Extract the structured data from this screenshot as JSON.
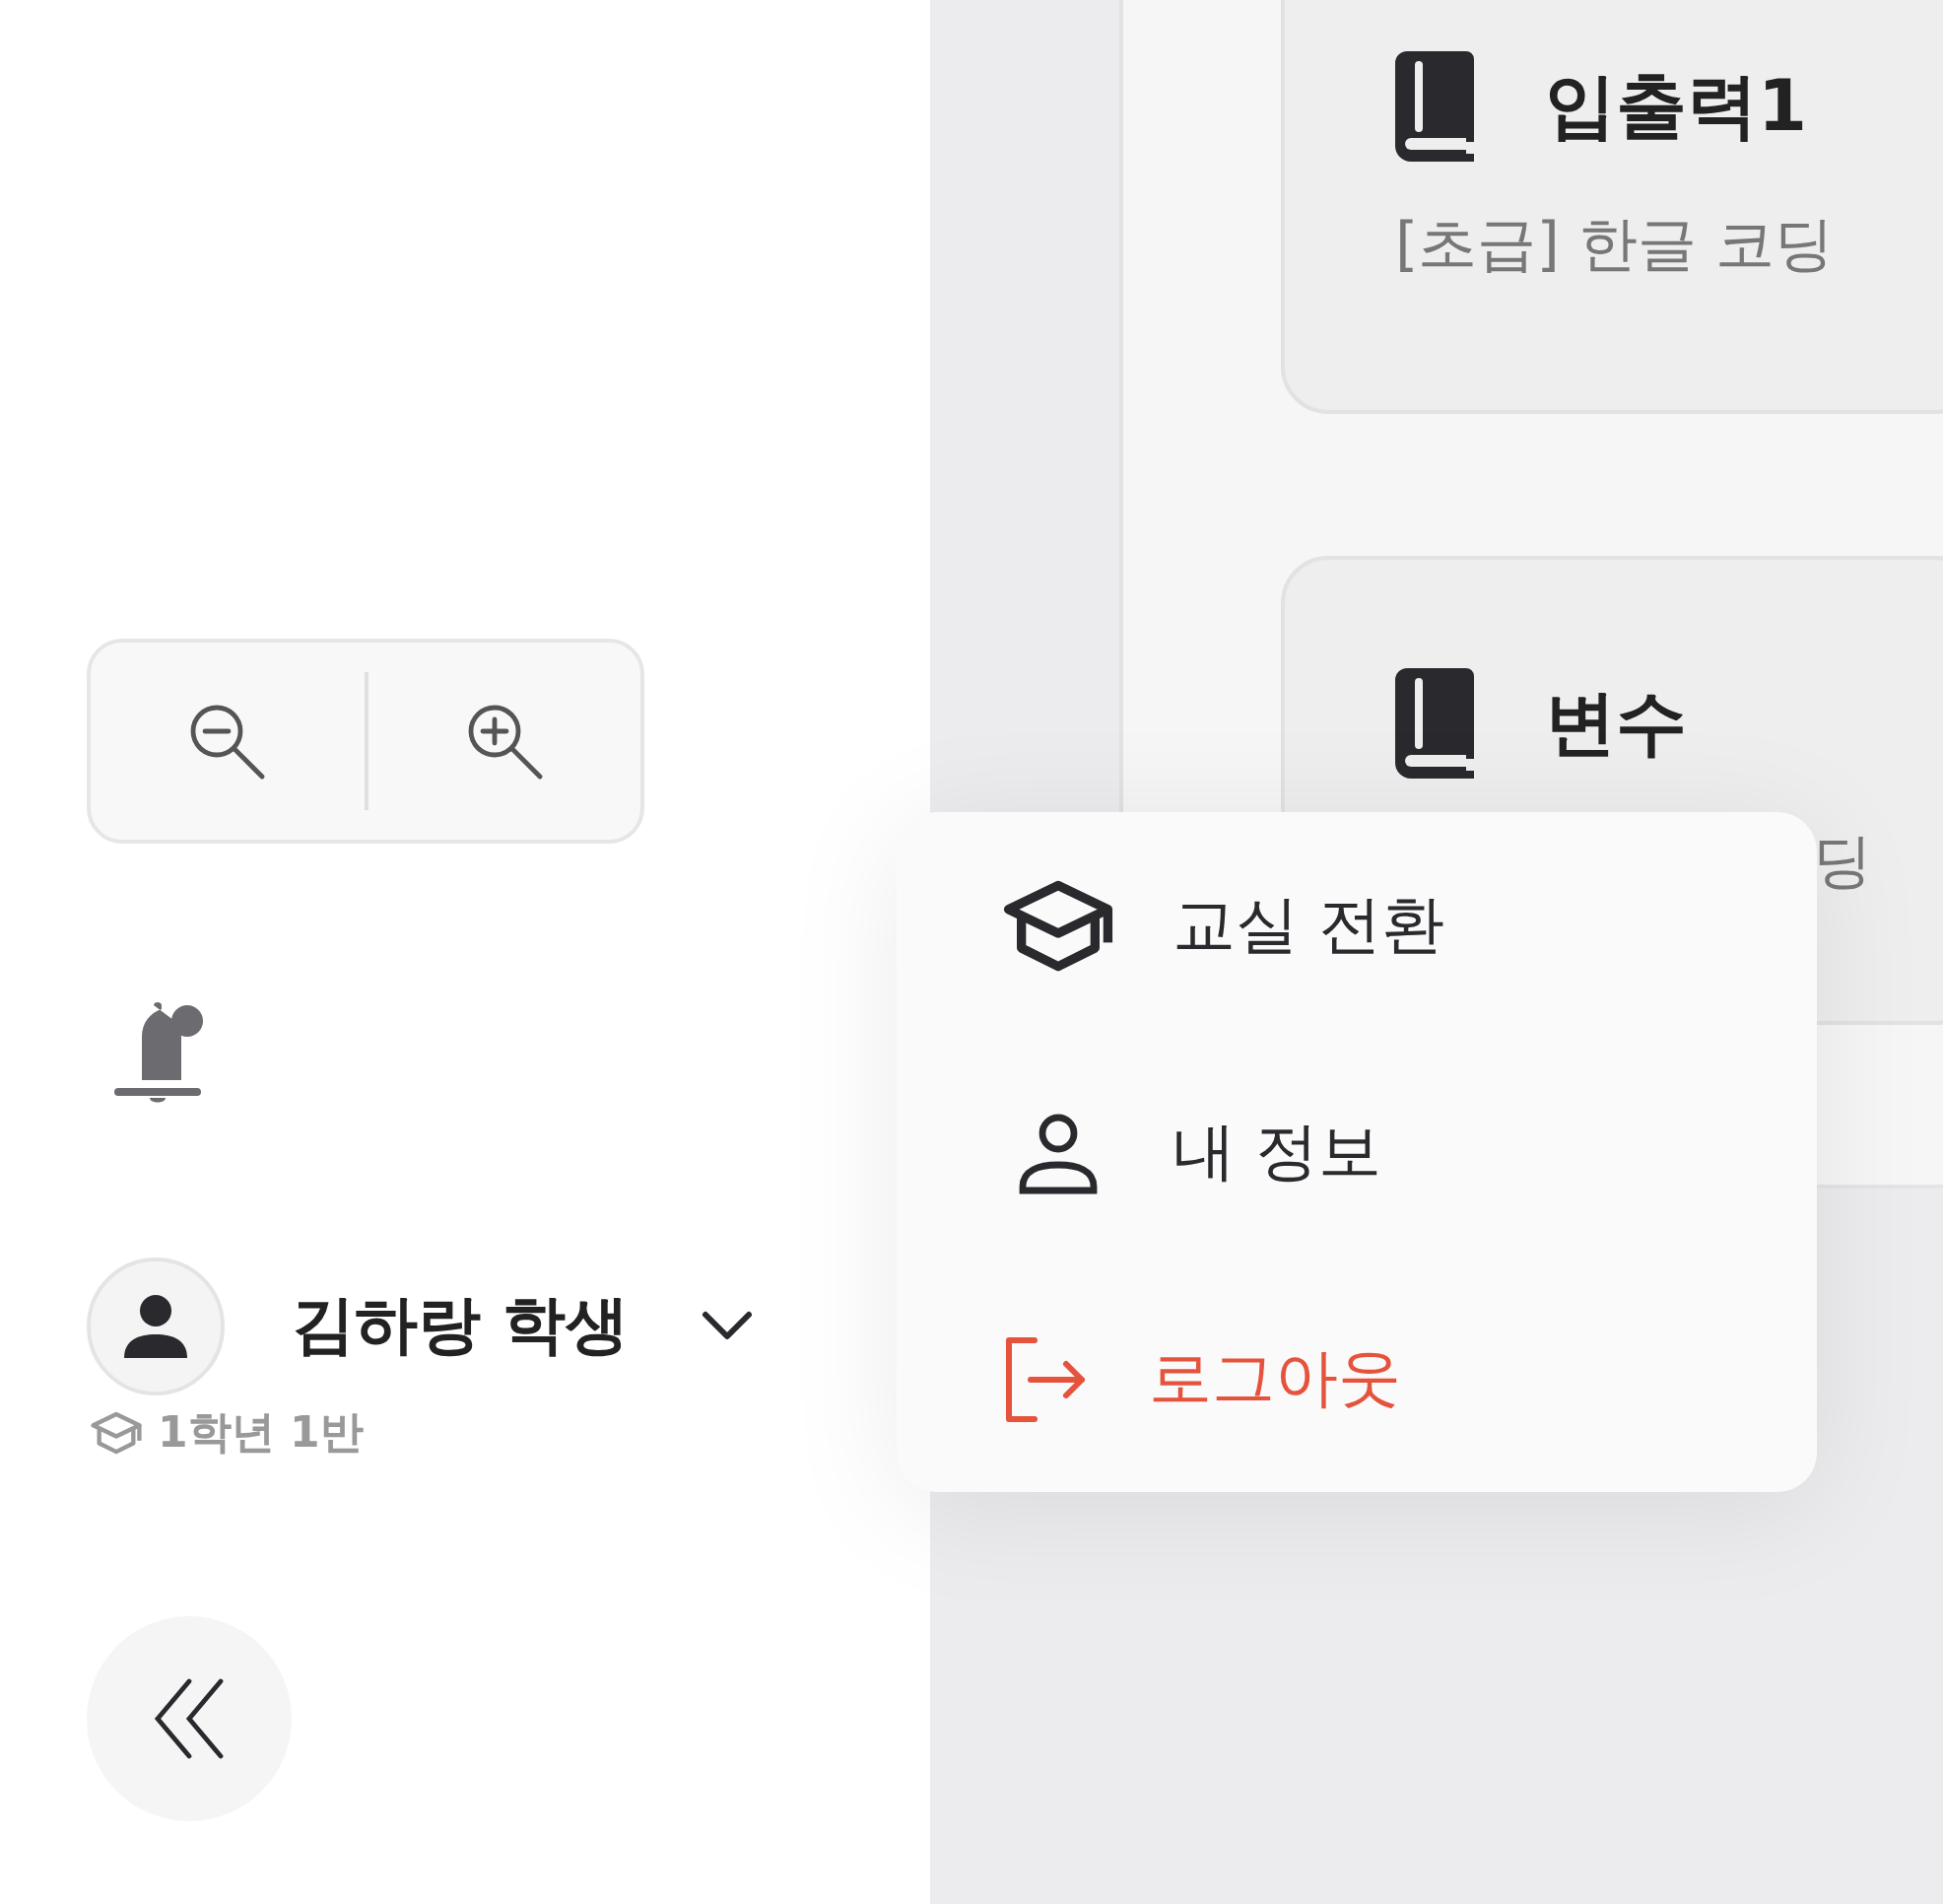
{
  "sidebar": {
    "zoom_controls": [
      {
        "kind": "zoom_out"
      },
      {
        "kind": "zoom_in"
      }
    ],
    "notifications": {
      "unread": true
    },
    "user": {
      "name": "김하랑 학생",
      "class": "1학년 1반",
      "menu_expanded": true
    }
  },
  "courses": [
    {
      "title": "입출력1",
      "description": "[초급] 한글 코딩"
    },
    {
      "title": "변수",
      "description": "딩",
      "description_covered": true
    }
  ],
  "user_menu": [
    {
      "kind": "classroom",
      "label": "교실 전환"
    },
    {
      "kind": "profile",
      "label": "내 정보"
    },
    {
      "kind": "logout",
      "label": "로그아웃"
    }
  ]
}
